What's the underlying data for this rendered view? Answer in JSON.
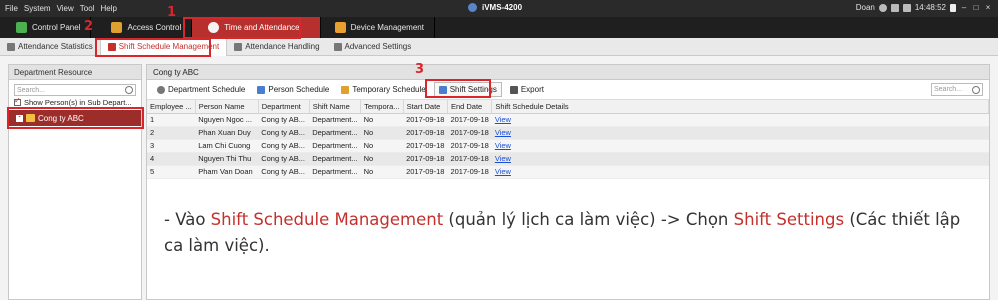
{
  "titlebar": {
    "menu": [
      "File",
      "System",
      "View",
      "Tool",
      "Help"
    ],
    "app_title": "iVMS-4200",
    "user": "Doan",
    "time": "14:48:52"
  },
  "modules": [
    {
      "label": "Control Panel",
      "icon": "grid-icon",
      "color": "#4caf50"
    },
    {
      "label": "Access Control",
      "icon": "door-icon",
      "color": "#e0a030"
    },
    {
      "label": "Time and Attendance",
      "icon": "clock-icon",
      "color": "#f4f4f4",
      "active": true
    },
    {
      "label": "Device Management",
      "icon": "device-icon",
      "color": "#e8a030"
    }
  ],
  "subtabs": [
    {
      "label": "Attendance Statistics"
    },
    {
      "label": "Shift Schedule Management",
      "active": true
    },
    {
      "label": "Attendance Handling"
    },
    {
      "label": "Advanced Settings"
    }
  ],
  "left": {
    "header": "Department Resource",
    "search_placeholder": "Search...",
    "checkbox_label": "Show Person(s) in Sub Depart...",
    "tree_item": "Cong ty ABC"
  },
  "main": {
    "header": "Cong ty ABC",
    "toolbar": {
      "department_schedule": "Department Schedule",
      "person_schedule": "Person Schedule",
      "temporary_schedule": "Temporary Schedule",
      "shift_settings": "Shift Settings",
      "export": "Export",
      "search_placeholder": "Search..."
    },
    "columns": [
      "Employee ...",
      "Person Name",
      "Department",
      "Shift Name",
      "Tempora...",
      "Start Date",
      "End Date",
      "Shift Schedule Details"
    ],
    "rows": [
      [
        "1",
        "Nguyen Ngoc ...",
        "Cong ty AB...",
        "Department...",
        "No",
        "2017-09-18",
        "2017-09-18",
        "View"
      ],
      [
        "2",
        "Phan Xuan Duy",
        "Cong ty AB...",
        "Department...",
        "No",
        "2017-09-18",
        "2017-09-18",
        "View"
      ],
      [
        "3",
        "Lam Chi Cuong",
        "Cong ty AB...",
        "Department...",
        "No",
        "2017-09-18",
        "2017-09-18",
        "View"
      ],
      [
        "4",
        "Nguyen Thi Thu",
        "Cong ty AB...",
        "Department...",
        "No",
        "2017-09-18",
        "2017-09-18",
        "View"
      ],
      [
        "5",
        "Pham Van Doan",
        "Cong ty AB...",
        "Department...",
        "No",
        "2017-09-18",
        "2017-09-18",
        "View"
      ]
    ]
  },
  "annotation": {
    "p1": "- Vào ",
    "h1": "Shift Schedule Management",
    "p2": " (quản lý lịch ca làm việc) -> Chọn ",
    "h2": "Shift Settings",
    "p3": " (Các thiết lập ca làm việc)."
  },
  "callouts": [
    "1",
    "2",
    "3"
  ],
  "colors": {
    "accent": "#c4302c",
    "callout": "#d8262a",
    "link": "#1a4fd6",
    "tree_selected": "#9d2d2a"
  }
}
